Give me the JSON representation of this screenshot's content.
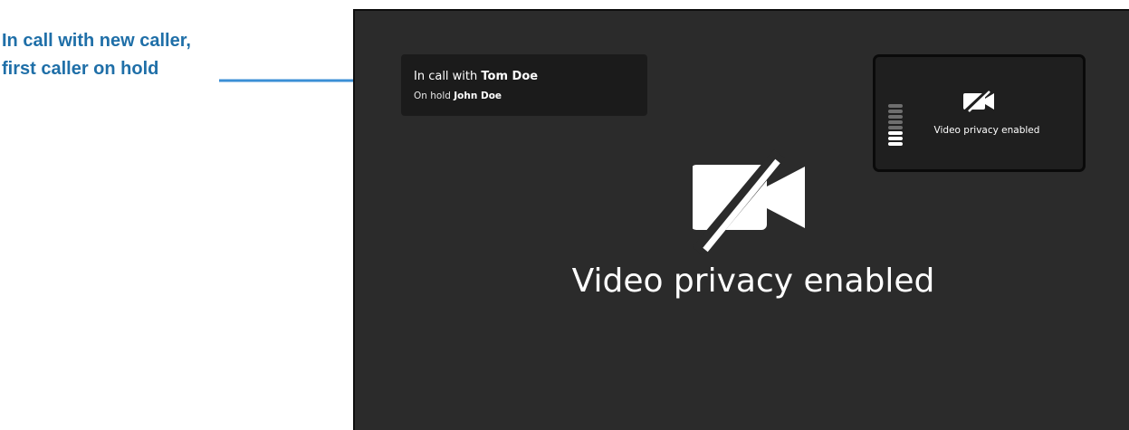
{
  "annotation": {
    "line1": "In call with new caller,",
    "line2": "first caller on hold",
    "arrow_color": "#3b8fd6"
  },
  "call_status": {
    "line1_prefix": "In call with ",
    "line1_name": "Tom Doe",
    "line2_prefix": "On hold ",
    "line2_name": "John Doe"
  },
  "self_view": {
    "label": "Video privacy enabled",
    "icon": "video-off-icon",
    "audio_meter": {
      "bars_total": 8,
      "bars_lit": 3
    }
  },
  "main_view": {
    "label": "Video privacy enabled",
    "icon": "video-off-icon"
  },
  "colors": {
    "screen_bg": "#2b2b2b",
    "panel_bg": "#1b1b1b",
    "callout_text": "#1f6fa8"
  }
}
